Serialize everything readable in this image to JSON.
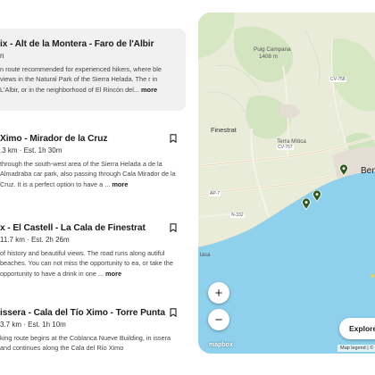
{
  "routes": [
    {
      "title": "ix - Alt de la Montera - Faro de l'Albir",
      "meta": "n",
      "desc": "n route recommended for experienced hikers, where ble views in the Natural Park of the Sierra Helada. The r in L'Albir, or in the neighborhood of El Rincón del...",
      "more": "more"
    },
    {
      "title": "Ximo - Mirador de la Cruz",
      "meta": ".3 km · Est. 1h 30m",
      "desc": "through the south-west area of the Sierra Helada a de la Almadraba car park, also passing through Cala Mirador de la Cruz. It is a perfect option to have a ...",
      "more": "more"
    },
    {
      "title": "x - El Castell - La Cala de Finestrat",
      "meta": "11.7 km · Est. 2h 26m",
      "desc": "of history and beautiful views. The road runs along autiful beaches. You can not miss the opportunity to ea, or take the opportunity to have a drink in one ...",
      "more": "more"
    },
    {
      "title": "issera - Cala del Tío Ximo - Torre Punta",
      "meta": "3.7 km · Est. 1h 10m",
      "desc": "king route begins at the Coblanca Nueve Building, in issera and continues along the Cala del Río Ximo",
      "more": ""
    }
  ],
  "map": {
    "labels": {
      "puig": "Puig Campana",
      "puig_alt": "1408 m",
      "finestrat": "Finestrat",
      "terra": "Terra Mítica",
      "benidorm": "Ben",
      "ap7": "AP-7",
      "n332": "N-332",
      "cv767": "CV-767",
      "cv758": "CV-758",
      "lasa": "lasa"
    },
    "zoom_in": "+",
    "zoom_out": "−",
    "explore": "Explore",
    "logo": "mapbox",
    "attribution": "Map legend | © Map"
  },
  "colors": {
    "sea": "#8fd0ec",
    "land": "#e9ecd9",
    "park": "#cfe3bd",
    "pin": "#2f5a1f",
    "road": "#f6f2e6"
  }
}
